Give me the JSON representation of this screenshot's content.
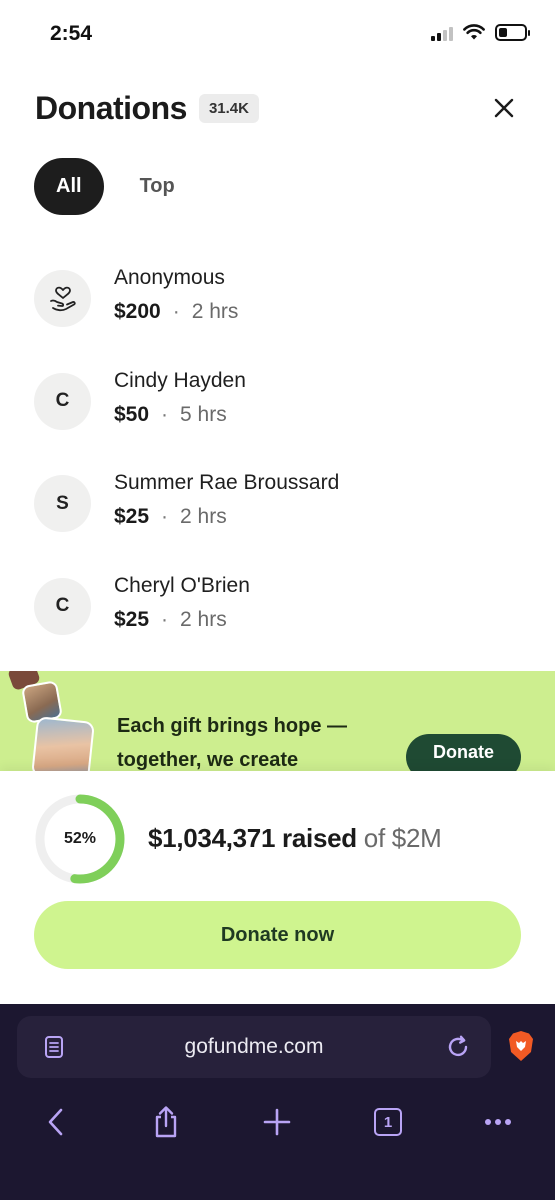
{
  "status_bar": {
    "time": "2:54"
  },
  "header": {
    "title": "Donations",
    "count": "31.4K"
  },
  "tabs": [
    {
      "label": "All",
      "active": true
    },
    {
      "label": "Top",
      "active": false
    }
  ],
  "donations": [
    {
      "initial": "",
      "icon": "hand-heart-icon",
      "name": "Anonymous",
      "amount": "$200",
      "time": "2 hrs"
    },
    {
      "initial": "C",
      "name": "Cindy Hayden",
      "amount": "$50",
      "time": "5 hrs"
    },
    {
      "initial": "S",
      "name": "Summer Rae Broussard",
      "amount": "$25",
      "time": "2 hrs"
    },
    {
      "initial": "C",
      "name": "Cheryl O'Brien",
      "amount": "$25",
      "time": "2 hrs"
    }
  ],
  "separator": "·",
  "banner": {
    "line1": "Each gift brings hope —",
    "line2": "together, we create",
    "donate_label": "Donate"
  },
  "progress": {
    "percent_label": "52%",
    "fraction": 0.52,
    "raised": "$1,034,371 raised",
    "goal_text": " of $2M",
    "donate_now_label": "Donate now"
  },
  "browser": {
    "url": "gofundme.com",
    "tab_count": "1"
  },
  "colors": {
    "accent_green": "#cff48f",
    "banner_green": "#cdee8f",
    "dark_green": "#1f4a33",
    "progress_green": "#7fcf5a",
    "browser_bg": "#1c1730",
    "browser_icon": "#b9a4f5"
  }
}
